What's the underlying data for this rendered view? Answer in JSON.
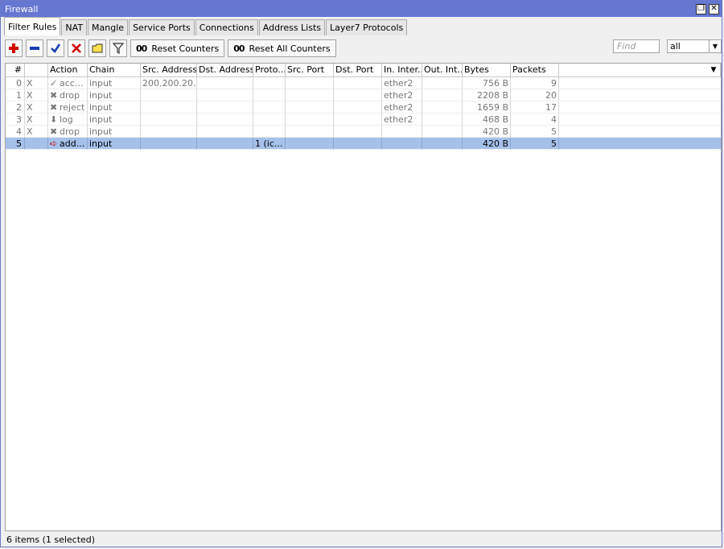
{
  "window": {
    "title": "Firewall",
    "restore_label": "❐",
    "close_label": "✕"
  },
  "tabs": [
    {
      "label": "Filter Rules"
    },
    {
      "label": "NAT"
    },
    {
      "label": "Mangle"
    },
    {
      "label": "Service Ports"
    },
    {
      "label": "Connections"
    },
    {
      "label": "Address Lists"
    },
    {
      "label": "Layer7 Protocols"
    }
  ],
  "toolbar": {
    "reset_counters_label": "Reset Counters",
    "reset_all_counters_label": "Reset All Counters",
    "oo_glyph": "00",
    "find_placeholder": "Find",
    "filter_value": "all",
    "filter_arrow": "▼"
  },
  "grid": {
    "menu_arrow": "▼",
    "columns": [
      "#",
      "",
      "Action",
      "Chain",
      "Src. Address",
      "Dst. Address",
      "Proto...",
      "Src. Port",
      "Dst. Port",
      "In. Inter...",
      "Out. Int...",
      "Bytes",
      "Packets"
    ],
    "rows": [
      {
        "num": "0",
        "flag": "X",
        "action_icon": "✓",
        "action": "acc...",
        "chain": "input",
        "src": "200.200.20...",
        "dst": "",
        "proto": "",
        "sport": "",
        "dport": "",
        "in": "ether2",
        "out": "",
        "bytes": "756 B",
        "packets": "9"
      },
      {
        "num": "1",
        "flag": "X",
        "action_icon": "✖",
        "action": "drop",
        "chain": "input",
        "src": "",
        "dst": "",
        "proto": "",
        "sport": "",
        "dport": "",
        "in": "ether2",
        "out": "",
        "bytes": "2208 B",
        "packets": "20"
      },
      {
        "num": "2",
        "flag": "X",
        "action_icon": "✖",
        "action": "reject",
        "chain": "input",
        "src": "",
        "dst": "",
        "proto": "",
        "sport": "",
        "dport": "",
        "in": "ether2",
        "out": "",
        "bytes": "1659 B",
        "packets": "17"
      },
      {
        "num": "3",
        "flag": "X",
        "action_icon": "⬇",
        "action": "log",
        "chain": "input",
        "src": "",
        "dst": "",
        "proto": "",
        "sport": "",
        "dport": "",
        "in": "ether2",
        "out": "",
        "bytes": "468 B",
        "packets": "4"
      },
      {
        "num": "4",
        "flag": "X",
        "action_icon": "✖",
        "action": "drop",
        "chain": "input",
        "src": "",
        "dst": "",
        "proto": "",
        "sport": "",
        "dport": "",
        "in": "",
        "out": "",
        "bytes": "420 B",
        "packets": "5"
      },
      {
        "num": "5",
        "flag": "",
        "action_icon": "➪",
        "action": "add...",
        "chain": "input",
        "src": "",
        "dst": "",
        "proto": "1 (ic...",
        "sport": "",
        "dport": "",
        "in": "",
        "out": "",
        "bytes": "420 B",
        "packets": "5",
        "selected": true
      }
    ]
  },
  "status": {
    "text": "6 items (1 selected)"
  },
  "colors": {
    "titlebar": "#6677d2",
    "selected_row": "#a5c1ea",
    "add_icon": "#d00000",
    "check_icon": "#1a3fb0"
  }
}
